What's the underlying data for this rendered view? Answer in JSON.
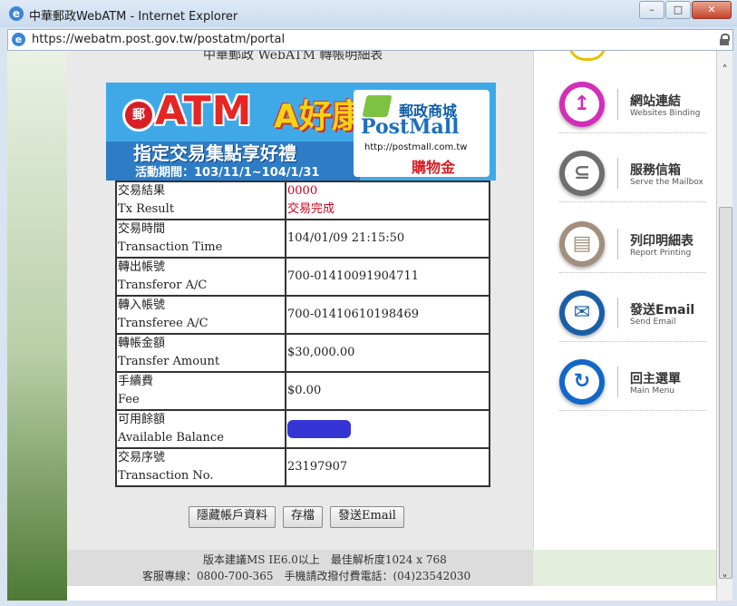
{
  "window": {
    "title": "中華郵政WebATM - Internet Explorer",
    "ie_icon_glyph": "e",
    "minimize_glyph": "–",
    "maximize_glyph": "□",
    "close_glyph": "✕",
    "url": "https://webatm.post.gov.tw/postatm/portal"
  },
  "page": {
    "report_title": "中華郵政 WebATM 轉帳明細表"
  },
  "banner": {
    "logo_text": "郵",
    "atm_text": "ATM",
    "good_text": "A好康",
    "subtitle": "指定交易集點享好禮",
    "period": "活動期間：103/11/1~104/1/31",
    "shop_name": "郵政商城",
    "shop_brand": "PostMall",
    "shop_url": "http://postmall.com.tw",
    "shop_gold": "購物金"
  },
  "transaction": {
    "rows": [
      {
        "label_cn": "交易結果",
        "label_en": "Tx Result",
        "value": "0000",
        "value2": "交易完成"
      },
      {
        "label_cn": "交易時間",
        "label_en": "Transaction Time",
        "value": "104/01/09 21:15:50"
      },
      {
        "label_cn": "轉出帳號",
        "label_en": "Transferor A/C",
        "value": "700-01410091904711"
      },
      {
        "label_cn": "轉入帳號",
        "label_en": "Transferee A/C",
        "value": "700-01410610198469"
      },
      {
        "label_cn": "轉帳金額",
        "label_en": "Transfer Amount",
        "value": "$30,000.00"
      },
      {
        "label_cn": "手續費",
        "label_en": "Fee",
        "value": "$0.00"
      },
      {
        "label_cn": "可用餘額",
        "label_en": "Available Balance",
        "value": ""
      },
      {
        "label_cn": "交易序號",
        "label_en": "Transaction No.",
        "value": "23197907"
      }
    ]
  },
  "buttons": {
    "hide_account": "隱藏帳戶資料",
    "save": "存檔",
    "send_email": "發送Email"
  },
  "footer": {
    "line1": "版本建議MS IE6.0以上　最佳解析度1024 x 768",
    "line2": "客服專線：0800-700-365　手機請改撥付費電話：(04)23542030"
  },
  "menu": {
    "items": [
      {
        "cn": "網站連結",
        "en": "Websites Binding",
        "glyph": "↥",
        "color": "#d12fb8"
      },
      {
        "cn": "服務信箱",
        "en": "Serve the Mailbox",
        "glyph": "⊆",
        "color": "#6e6e6e"
      },
      {
        "cn": "列印明細表",
        "en": "Report Printing",
        "glyph": "▤",
        "color": "#a28f7e"
      },
      {
        "cn": "發送Email",
        "en": "Send Email",
        "glyph": "✉",
        "color": "#1a5fa6"
      },
      {
        "cn": "回主選單",
        "en": "Main Menu",
        "glyph": "↻",
        "color": "#1268c9"
      }
    ]
  },
  "scrollbar": {
    "up_glyph": "˄",
    "down_glyph": "˅"
  }
}
